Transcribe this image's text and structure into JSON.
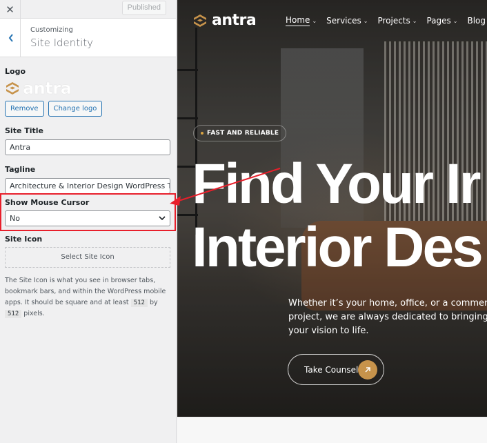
{
  "topbar": {
    "close_glyph": "✕",
    "publish_label": "Published"
  },
  "section": {
    "subtitle": "Customizing",
    "title": "Site Identity"
  },
  "logo": {
    "label": "Logo",
    "brand": "antra",
    "remove_label": "Remove",
    "change_label": "Change logo"
  },
  "site_title": {
    "label": "Site Title",
    "value": "Antra"
  },
  "tagline": {
    "label": "Tagline",
    "value": "Architecture & Interior Design WordPress Theme"
  },
  "cursor": {
    "label": "Show Mouse Cursor",
    "value": "No"
  },
  "site_icon": {
    "label": "Site Icon",
    "button": "Select Site Icon",
    "desc_1": "The Site Icon is what you see in browser tabs, bookmark bars, and within the WordPress mobile apps. It should be square and at least",
    "size_a": "512",
    "by": "by",
    "size_b": "512",
    "desc_2": "pixels."
  },
  "preview": {
    "brand": "antra",
    "nav": [
      {
        "label": "Home"
      },
      {
        "label": "Services"
      },
      {
        "label": "Projects"
      },
      {
        "label": "Pages"
      },
      {
        "label": "Blog"
      }
    ],
    "badge": "FAST AND RELIABLE",
    "heading_line1": "Find Your Ir",
    "heading_line2": "Interior Des",
    "paragraph": "Whether it’s your home, office, or a commerc project, we are always dedicated to bringing your vision to life.",
    "cta": "Take Counsel"
  },
  "colors": {
    "accent": "#2271b1",
    "brand_gold": "#c7934b",
    "highlight": "#e81f2b"
  },
  "icons": [
    "close-icon",
    "chevron-left-icon",
    "logo-mark-icon",
    "chevron-down-icon",
    "caret-down-icon",
    "arrow-up-right-icon"
  ]
}
